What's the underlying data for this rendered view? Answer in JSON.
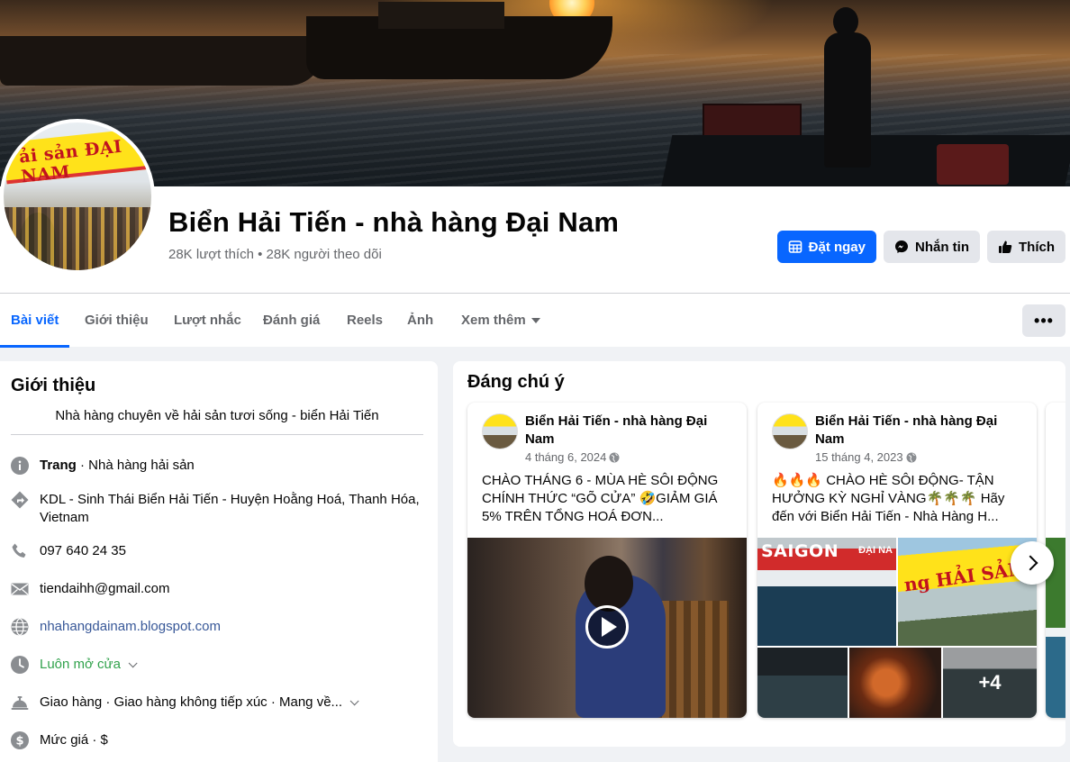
{
  "page": {
    "title": "Biển Hải Tiến - nhà hàng Đại Nam",
    "stats": "28K lượt thích • 28K người theo dõi",
    "avatar_sign": "ải sản ĐẠI NAM"
  },
  "actions": {
    "book": "Đặt ngay",
    "message": "Nhắn tin",
    "like": "Thích"
  },
  "tabs": [
    {
      "label": "Bài viết",
      "active": true
    },
    {
      "label": "Giới thiệu"
    },
    {
      "label": "Lượt nhắc"
    },
    {
      "label": "Đánh giá"
    },
    {
      "label": "Reels"
    },
    {
      "label": "Ảnh"
    },
    {
      "label": "Xem thêm"
    }
  ],
  "more_label": "•••",
  "intro": {
    "heading": "Giới thiệu",
    "description": "Nhà hàng chuyên về hải sản tươi sống - biển Hải Tiến",
    "category_label": "Trang",
    "category_value": " · Nhà hàng hải sản",
    "address": "KDL - Sinh Thái Biển Hải Tiến - Huyện Hoằng Hoá, Thanh Hóa, Vietnam",
    "phone": "097 640 24 35",
    "email": "tiendaihh@gmail.com",
    "website": "nhahangdainam.blogspot.com",
    "hours": "Luôn mở cửa",
    "delivery": "Giao hàng · Giao hàng không tiếp xúc · Mang về...",
    "price": "Mức giá · $"
  },
  "notable": {
    "heading": "Đáng chú ý",
    "posts": [
      {
        "author": "Biển Hải Tiến - nhà hàng Đại Nam",
        "date": "4 tháng 6, 2024",
        "text": "CHÀO THÁNG 6 - MÙA HÈ SÔI ĐỘNG CHÍNH THỨC “GÕ CỬA” 🤣GIẢM GIÁ 5% TRÊN TỔNG HOÁ ĐƠN..."
      },
      {
        "author": "Biển Hải Tiến - nhà hàng Đại Nam",
        "date": "15 tháng 4, 2023",
        "text": "🔥🔥🔥 CHÀO HÈ SÔI ĐỘNG- TẬN HƯỞNG KỲ NGHỈ VÀNG🌴🌴🌴 Hãy đến với Biển Hải Tiến - Nhà Hàng H...",
        "photo_sign_1": "SAIGON",
        "photo_sign_1b": "ĐẠI NA",
        "photo_sign_2": "ng HẢI SẢN ĐẠI N",
        "more_photos": "+4"
      }
    ]
  },
  "colors": {
    "accent": "#0866ff",
    "background": "#f0f2f5",
    "secondary_text": "#65676b",
    "open_status": "#31a24c"
  }
}
